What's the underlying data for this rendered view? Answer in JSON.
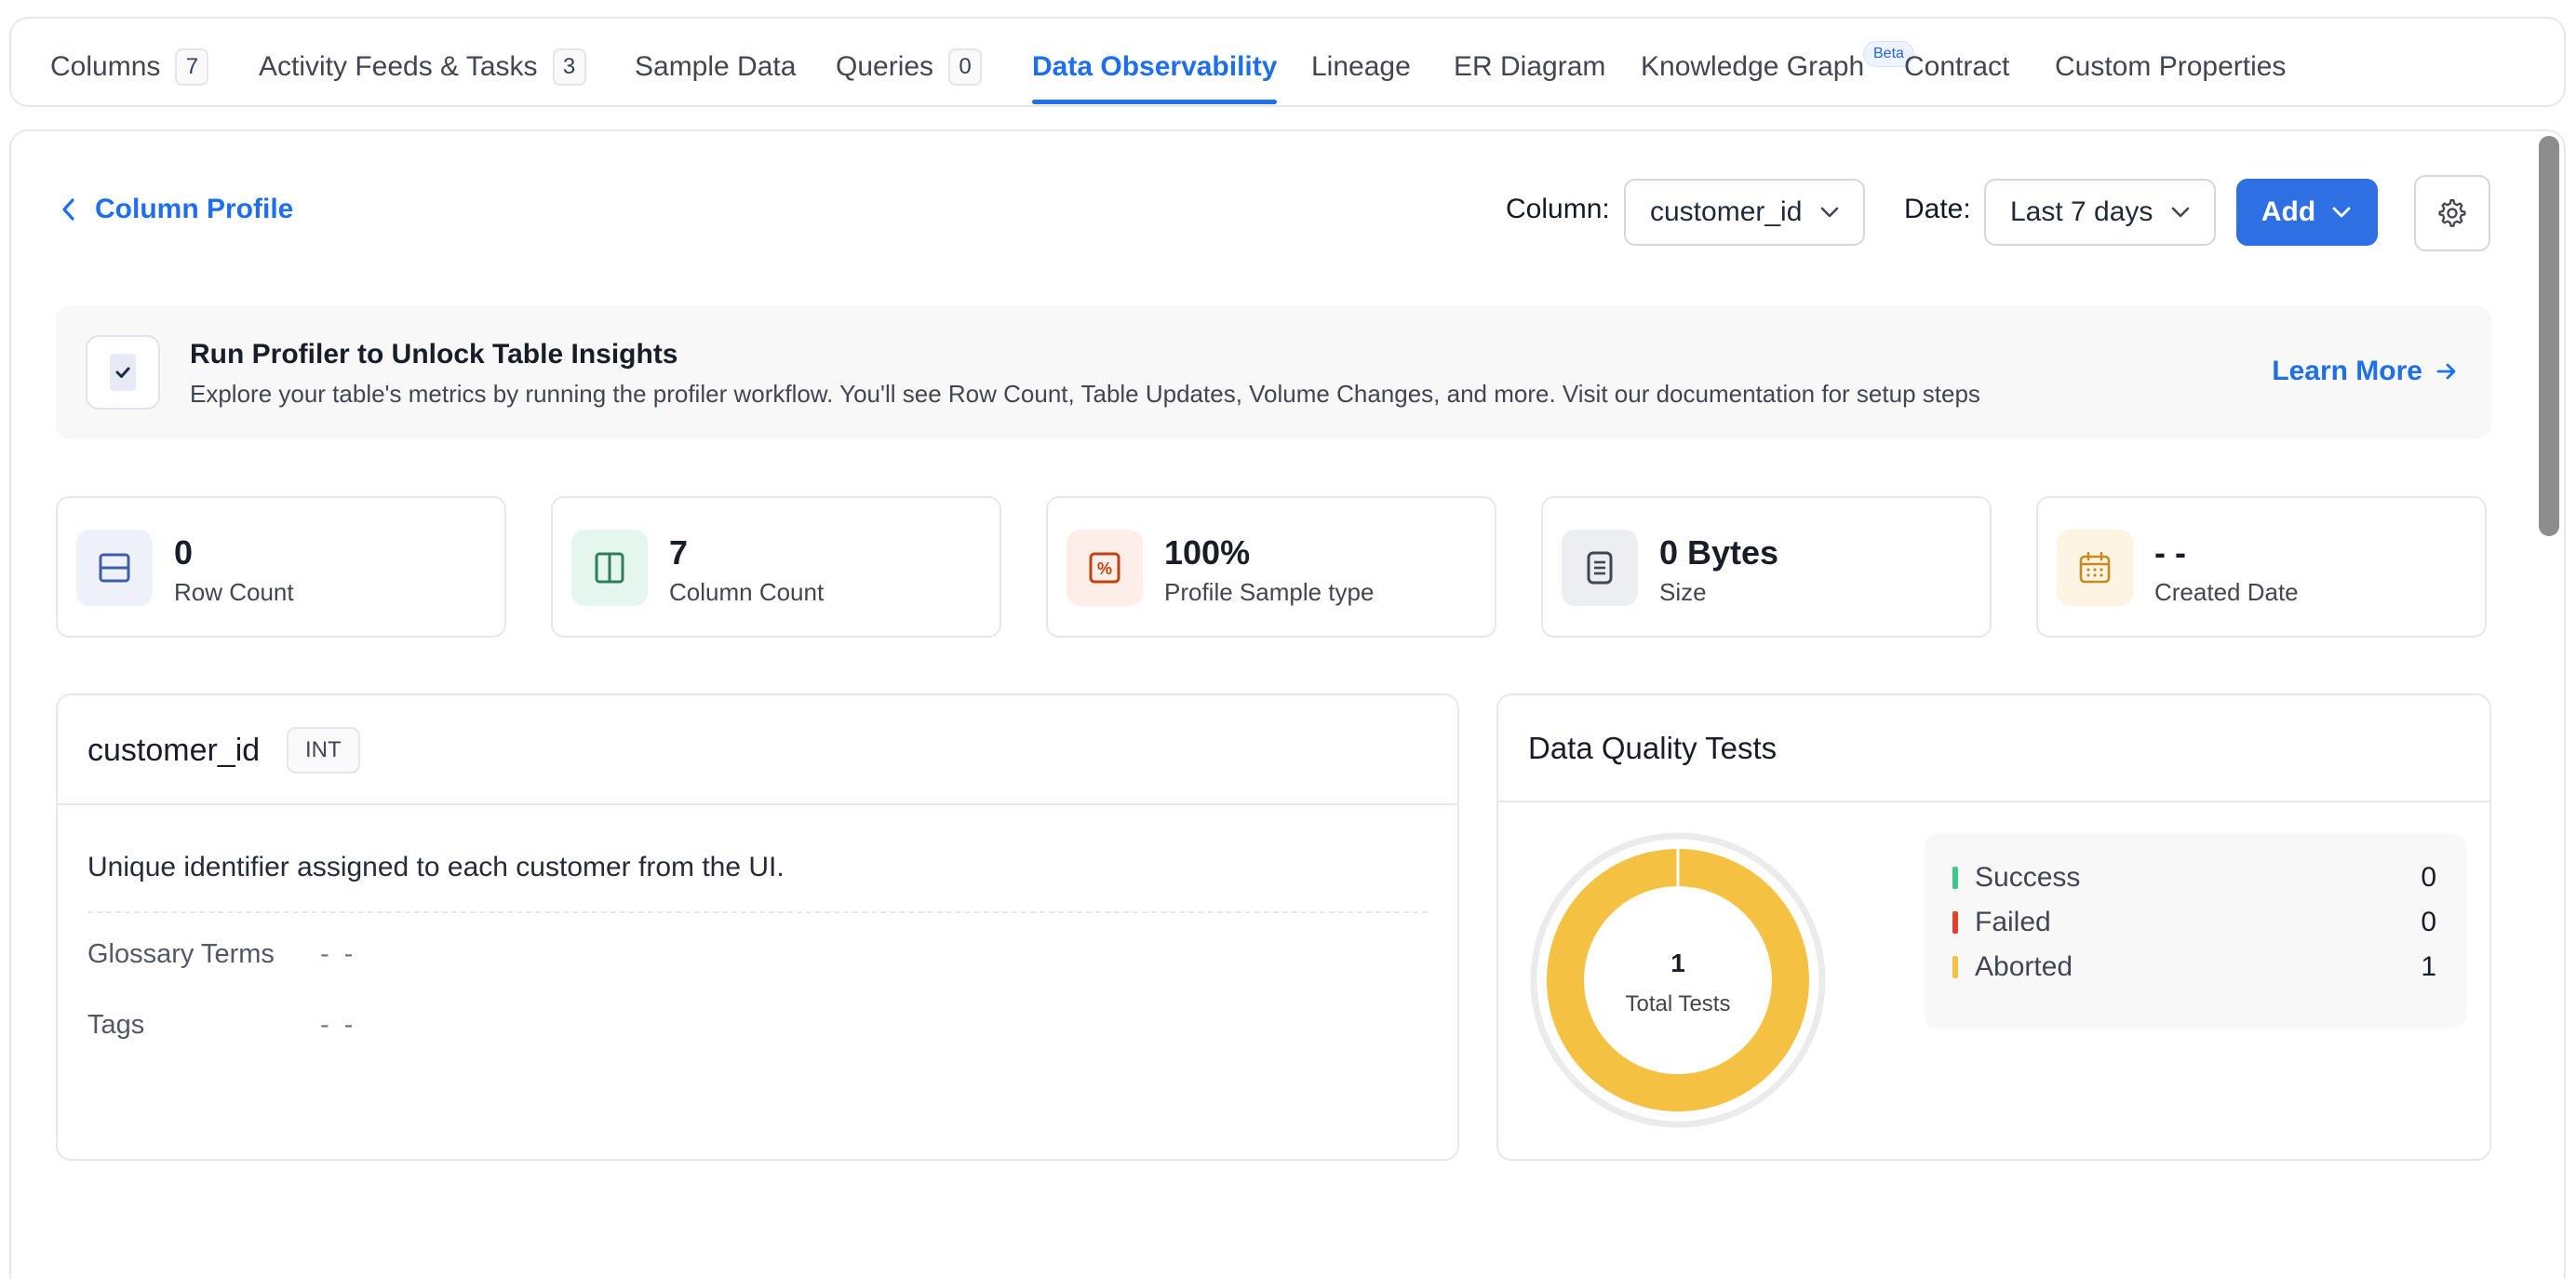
{
  "tabs": [
    {
      "label": "Columns",
      "count": "7"
    },
    {
      "label": "Activity Feeds & Tasks",
      "count": "3"
    },
    {
      "label": "Sample Data"
    },
    {
      "label": "Queries",
      "count": "0"
    },
    {
      "label": "Data Observability",
      "active": true
    },
    {
      "label": "Lineage"
    },
    {
      "label": "ER Diagram"
    },
    {
      "label": "Knowledge Graph",
      "badge": "Beta"
    },
    {
      "label": "Contract"
    },
    {
      "label": "Custom Properties"
    }
  ],
  "header": {
    "back_label": "Column Profile",
    "column_label": "Column:",
    "column_value": "customer_id",
    "date_label": "Date:",
    "date_value": "Last 7 days",
    "add_label": "Add"
  },
  "banner": {
    "title": "Run Profiler to Unlock Table Insights",
    "description": "Explore your table's metrics by running the profiler workflow. You'll see Row Count, Table Updates, Volume Changes, and more. Visit our documentation for setup steps",
    "link": "Learn More"
  },
  "stats": [
    {
      "value": "0",
      "label": "Row Count",
      "icon": "row-icon",
      "color": "#3d5ea8",
      "bg": "#eef1fa"
    },
    {
      "value": "7",
      "label": "Column Count",
      "icon": "column-icon",
      "color": "#2e7d5b",
      "bg": "#e4f6ee"
    },
    {
      "value": "100%",
      "label": "Profile Sample type",
      "icon": "percent-icon",
      "color": "#c2410c",
      "bg": "#fdeeea"
    },
    {
      "value": "0 Bytes",
      "label": "Size",
      "icon": "document-icon",
      "color": "#414651",
      "bg": "#eceef1"
    },
    {
      "value": "- -",
      "label": "Created Date",
      "icon": "calendar-icon",
      "color": "#c98a1e",
      "bg": "#fdf4e4"
    }
  ],
  "column": {
    "name": "customer_id",
    "type": "INT",
    "description": "Unique identifier assigned to each customer from the UI.",
    "glossary_label": "Glossary Terms",
    "glossary_value": "- -",
    "tags_label": "Tags",
    "tags_value": "- -"
  },
  "data_quality": {
    "title": "Data Quality Tests",
    "total": "1",
    "total_label": "Total Tests",
    "items": [
      {
        "label": "Success",
        "value": 0,
        "color": "#3ec98a"
      },
      {
        "label": "Failed",
        "value": 0,
        "color": "#e5412a"
      },
      {
        "label": "Aborted",
        "value": 1,
        "color": "#f4c142"
      }
    ]
  }
}
